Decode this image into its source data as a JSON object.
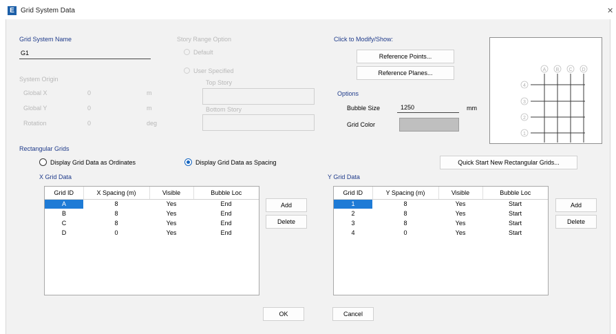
{
  "window": {
    "title": "Grid System Data",
    "app_icon": "E"
  },
  "grid_system_name": {
    "label": "Grid System Name",
    "value": "G1"
  },
  "system_origin": {
    "label": "System Origin",
    "global_x": {
      "label": "Global X",
      "value": "0",
      "unit": "m"
    },
    "global_y": {
      "label": "Global Y",
      "value": "0",
      "unit": "m"
    },
    "rotation": {
      "label": "Rotation",
      "value": "0",
      "unit": "deg"
    }
  },
  "story_range": {
    "label": "Story Range Option",
    "default_label": "Default",
    "user_specified_label": "User Specified",
    "top_story_label": "Top Story",
    "bottom_story_label": "Bottom Story"
  },
  "modify_show": {
    "label": "Click to Modify/Show:",
    "reference_points": "Reference Points...",
    "reference_planes": "Reference Planes..."
  },
  "options": {
    "label": "Options",
    "bubble_size_label": "Bubble Size",
    "bubble_size_value": "1250",
    "bubble_size_unit": "mm",
    "grid_color_label": "Grid Color",
    "grid_color": "#bfbfbf"
  },
  "preview": {
    "x_bubbles": [
      "A",
      "B",
      "C",
      "D"
    ],
    "y_bubbles": [
      "4",
      "3",
      "2",
      "1"
    ]
  },
  "rectangular_grids": {
    "label": "Rectangular Grids",
    "ordinates_label": "Display Grid Data as Ordinates",
    "spacing_label": "Display Grid Data as Spacing",
    "quick_start": "Quick Start New Rectangular Grids..."
  },
  "x_grid": {
    "label": "X Grid Data",
    "headers": [
      "Grid ID",
      "X Spacing  (m)",
      "Visible",
      "Bubble Loc"
    ],
    "rows": [
      {
        "id": "A",
        "spacing": "8",
        "visible": "Yes",
        "bubble": "End"
      },
      {
        "id": "B",
        "spacing": "8",
        "visible": "Yes",
        "bubble": "End"
      },
      {
        "id": "C",
        "spacing": "8",
        "visible": "Yes",
        "bubble": "End"
      },
      {
        "id": "D",
        "spacing": "0",
        "visible": "Yes",
        "bubble": "End"
      }
    ],
    "add": "Add",
    "delete": "Delete"
  },
  "y_grid": {
    "label": "Y Grid Data",
    "headers": [
      "Grid ID",
      "Y Spacing  (m)",
      "Visible",
      "Bubble Loc"
    ],
    "rows": [
      {
        "id": "1",
        "spacing": "8",
        "visible": "Yes",
        "bubble": "Start"
      },
      {
        "id": "2",
        "spacing": "8",
        "visible": "Yes",
        "bubble": "Start"
      },
      {
        "id": "3",
        "spacing": "8",
        "visible": "Yes",
        "bubble": "Start"
      },
      {
        "id": "4",
        "spacing": "0",
        "visible": "Yes",
        "bubble": "Start"
      }
    ],
    "add": "Add",
    "delete": "Delete"
  },
  "footer": {
    "ok": "OK",
    "cancel": "Cancel"
  },
  "colors": {
    "accent": "#1e7bd6",
    "header_text": "#1e3a8a",
    "disabled_text": "#b8b8b8"
  }
}
